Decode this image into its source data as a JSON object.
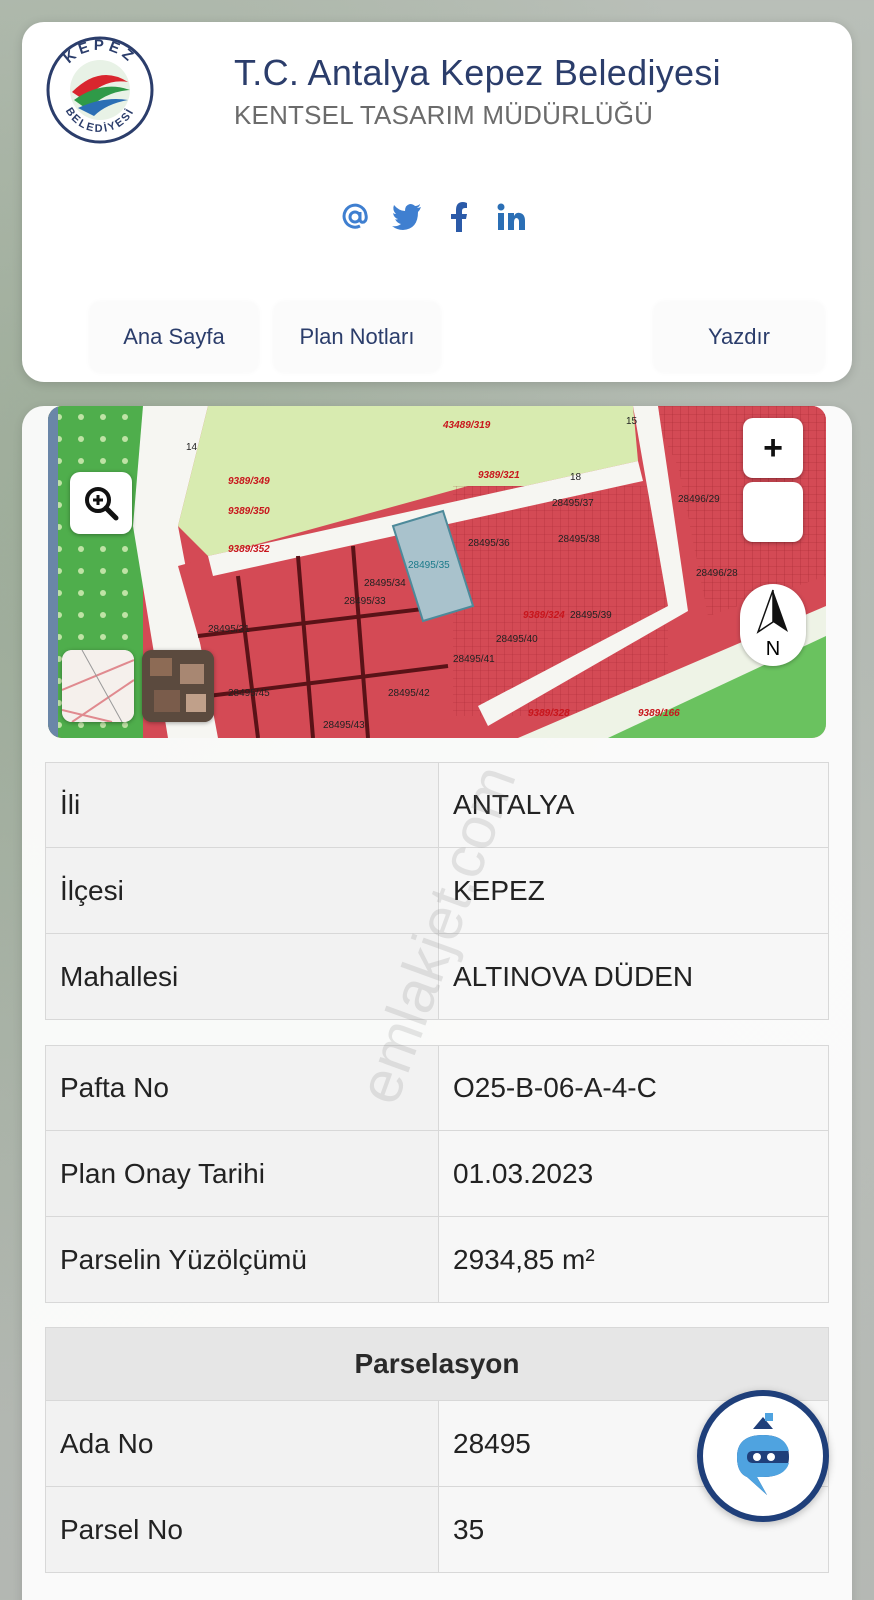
{
  "header": {
    "title": "T.C. Antalya Kepez Belediyesi",
    "subtitle": "KENTSEL TASARIM MÜDÜRLÜĞÜ",
    "logo_text_top": "KEPEZ",
    "logo_text_bottom": "BELEDİYESİ"
  },
  "social": {
    "icons": [
      "at-icon",
      "twitter-icon",
      "facebook-icon",
      "linkedin-icon"
    ],
    "color": "#3f7fd0"
  },
  "nav": {
    "home": "Ana Sayfa",
    "plan_notes": "Plan Notları",
    "print": "Yazdır"
  },
  "map": {
    "zoom_in_label": "+",
    "compass_label": "N",
    "labels": {
      "parcel_highlight": "28495/35",
      "p37": "28495/37",
      "p36": "28495/36",
      "p38": "28495/38",
      "p34": "28495/34",
      "p33": "28495/33",
      "p31": "28495/31",
      "p39": "28495/39",
      "p40": "28495/40",
      "p41": "28495/41",
      "p42": "28495/42",
      "p43": "28495/43",
      "p45": "28495/45",
      "p29": "28496/29",
      "p28": "28496/28",
      "r349": "9389/349",
      "r321": "9389/321",
      "r324": "9389/324",
      "r328": "9389/328",
      "r352": "9389/352",
      "r350": "9389/350",
      "r166": "9389/166",
      "r319": "43489/319",
      "road14": "14",
      "road15": "15",
      "road18": "18"
    }
  },
  "info_rows": [
    {
      "label": "İli",
      "value": "ANTALYA"
    },
    {
      "label": "İlçesi",
      "value": "KEPEZ"
    },
    {
      "label": "Mahallesi",
      "value": "ALTINOVA DÜDEN"
    }
  ],
  "plan_rows": [
    {
      "label": "Pafta No",
      "value": "O25-B-06-A-4-C"
    },
    {
      "label": "Plan Onay Tarihi",
      "value": "01.03.2023"
    },
    {
      "label": "Parselin Yüzölçümü",
      "value": "2934,85 m²"
    }
  ],
  "parcel": {
    "section_title": "Parselasyon",
    "rows": [
      {
        "label": "Ada No",
        "value": "28495"
      },
      {
        "label": "Parsel No",
        "value": "35"
      }
    ]
  },
  "watermark": "emlakjet.com",
  "colors": {
    "brand": "#2b3d6b",
    "fab_border": "#1f3f7a",
    "map_red": "#d44a55",
    "map_green": "#d8ebb0"
  }
}
